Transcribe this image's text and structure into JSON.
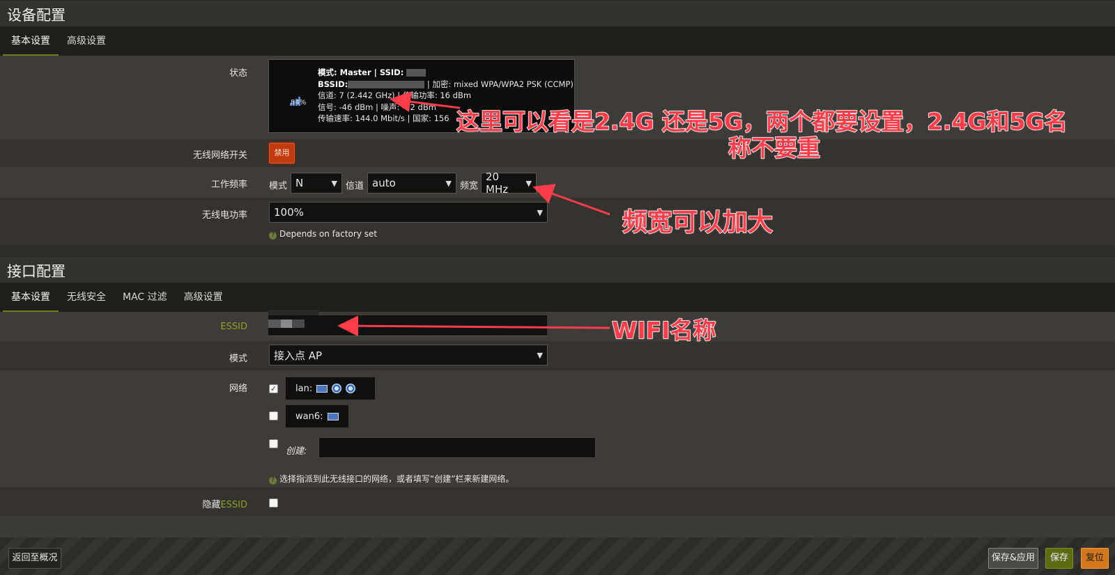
{
  "device_config": {
    "title": "设备配置",
    "tabs": [
      "基本设置",
      "高级设置"
    ],
    "status": {
      "label": "状态",
      "signal_percent": "84%",
      "line1_mode": "模式: Master | SSID:",
      "line2_bssid": "BSSID:",
      "line2_enc": "| 加密: mixed WPA/WPA2 PSK (CCMP)",
      "line3": "信道: 7 (2.442 GHz) | 传输功率: 16 dBm",
      "line4": "信号: -46 dBm | 噪声: -72 dBm",
      "line5": "传输速率: 144.0 Mbit/s | 国家: 156"
    },
    "wireless_switch": {
      "label": "无线网络开关",
      "button": "禁用"
    },
    "frequency": {
      "label": "工作频率",
      "mode_label": "模式",
      "mode_value": "N",
      "channel_label": "信道",
      "channel_value": "auto",
      "width_label": "频宽",
      "width_value": "20 MHz"
    },
    "tx_power": {
      "label": "无线电功率",
      "value": "100%",
      "help": "Depends on factory set"
    }
  },
  "interface_config": {
    "title": "接口配置",
    "tabs": [
      "基本设置",
      "无线安全",
      "MAC 过滤",
      "高级设置"
    ],
    "essid": {
      "label": "ESSID"
    },
    "mode": {
      "label": "模式",
      "value": "接入点 AP"
    },
    "network": {
      "label": "网络",
      "lan": "lan:",
      "wan6": "wan6:",
      "create_label": "创建:",
      "help": "选择指派到此无线接口的网络，或者填写“创建”栏来新建网络。"
    },
    "hide_essid": {
      "label_prefix": "隐藏",
      "label_suffix": "ESSID"
    }
  },
  "footer": {
    "back": "返回至概况",
    "save_apply": "保存&应用",
    "save": "保存",
    "reset": "复位"
  },
  "annotations": {
    "band_line1": "这里可以看是2.4G 还是5G，两个都要设置，2.4G和5G名",
    "band_line2": "称不要重",
    "width": "频宽可以加大",
    "wifi": "WIFI名称"
  },
  "colors": {
    "accent_green": "#6e7b1e",
    "disable_btn": "#c23b10",
    "annotation": "#ff3d4a"
  }
}
